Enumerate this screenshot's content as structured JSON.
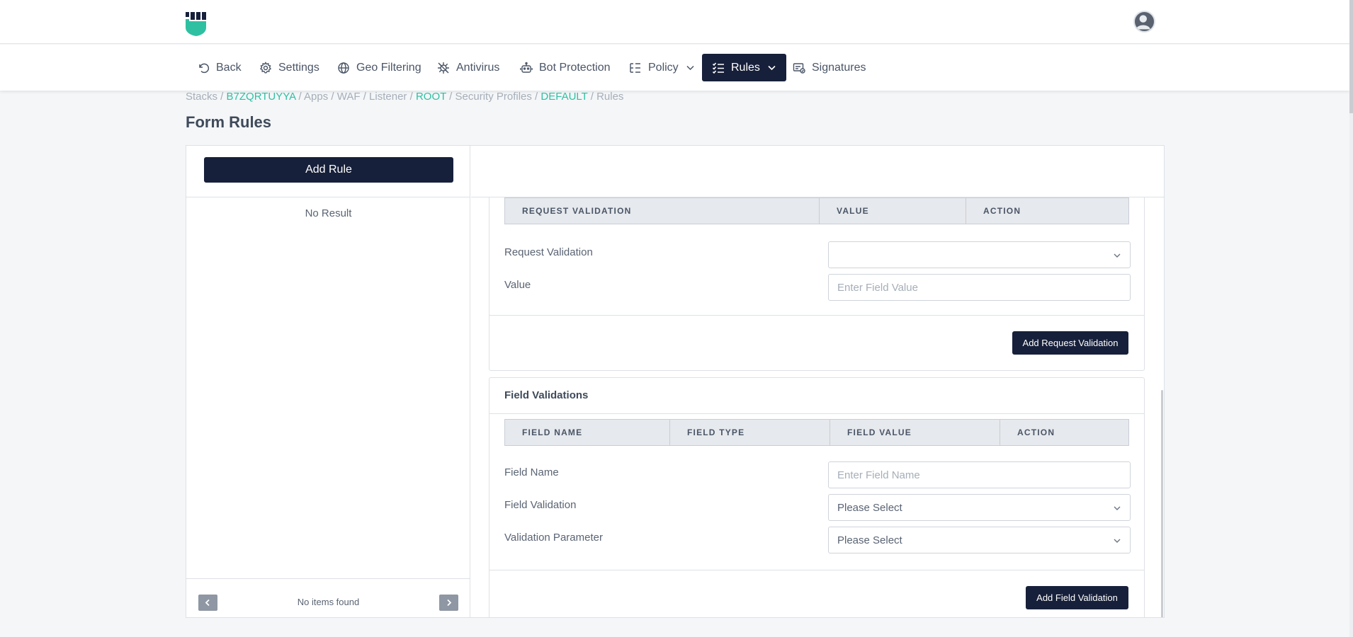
{
  "nav": {
    "back": "Back",
    "settings": "Settings",
    "geo_filtering": "Geo Filtering",
    "antivirus": "Antivirus",
    "bot_protection": "Bot Protection",
    "policy": "Policy",
    "rules": "Rules",
    "signatures": "Signatures"
  },
  "breadcrumb": {
    "stacks": "Stacks",
    "stack_id": "B7ZQRTUYYA",
    "apps": "Apps",
    "waf": "WAF",
    "listener": "Listener",
    "root": "ROOT",
    "security_profiles": "Security Profiles",
    "default": "DEFAULT",
    "rules": "Rules",
    "sep": " / "
  },
  "page": {
    "title": "Form Rules"
  },
  "left_panel": {
    "add_rule": "Add Rule",
    "empty": "No Result",
    "pagination_empty": "No items found"
  },
  "request_validation": {
    "columns": [
      "REQUEST VALIDATION",
      "VALUE",
      "ACTION"
    ],
    "request_validation_label": "Request Validation",
    "request_validation_value": "",
    "value_label": "Value",
    "value_placeholder": "Enter Field Value",
    "add_button": "Add Request Validation"
  },
  "field_validations": {
    "title": "Field Validations",
    "columns": [
      "FIELD NAME",
      "FIELD TYPE",
      "FIELD VALUE",
      "ACTION"
    ],
    "field_name_label": "Field Name",
    "field_name_placeholder": "Enter Field Name",
    "field_validation_label": "Field Validation",
    "field_validation_value": "Please Select",
    "validation_parameter_label": "Validation Parameter",
    "validation_parameter_value": "Please Select",
    "add_button": "Add Field Validation"
  },
  "colors": {
    "primary_dark": "#17203a",
    "accent": "#2fc0a2"
  }
}
